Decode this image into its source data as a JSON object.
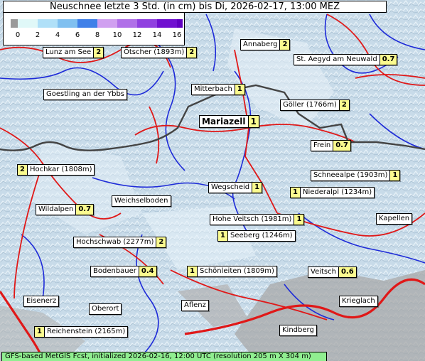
{
  "title": "Neuschnee letzte 3 Std. (in cm) bis Di, 2026-02-17, 13:00 MEZ",
  "legend": {
    "ticks": [
      "0",
      "2",
      "4",
      "6",
      "8",
      "10",
      "12",
      "14",
      "16"
    ],
    "colors": [
      "#e0f8f8",
      "#b0e0f8",
      "#80c0f0",
      "#4080e8",
      "#d0a0f0",
      "#b070e8",
      "#9040e0",
      "#7010d0"
    ],
    "start_color": "#9a9a9a",
    "end_color": "#6000c0"
  },
  "places": [
    {
      "name": "Lunz am See",
      "value": "2"
    },
    {
      "name": "Ötscher (1893m)",
      "value": "2"
    },
    {
      "name": "Annaberg",
      "value": "2"
    },
    {
      "name": "St. Aegyd am Neuwald",
      "value": "0.7"
    },
    {
      "name": "Goestling an der Ybbs",
      "value": ""
    },
    {
      "name": "Mitterbach",
      "value": "1"
    },
    {
      "name": "Göller (1766m)",
      "value": "2"
    },
    {
      "name": "Mariazell",
      "value": "1"
    },
    {
      "name": "Frein",
      "value": "0.7"
    },
    {
      "name": "Hochkar (1808m)",
      "value": "2"
    },
    {
      "name": "Schneealpe (1903m)",
      "value": "1"
    },
    {
      "name": "Wegscheid",
      "value": "1"
    },
    {
      "name": "Niederalpl (1234m)",
      "value": "1"
    },
    {
      "name": "Weichselboden",
      "value": ""
    },
    {
      "name": "Wildalpen",
      "value": "0.7"
    },
    {
      "name": "Hohe Veitsch (1981m)",
      "value": "1"
    },
    {
      "name": "Kapellen",
      "value": ""
    },
    {
      "name": "Seeberg (1246m)",
      "value": "1"
    },
    {
      "name": "Hochschwab (2277m)",
      "value": "2"
    },
    {
      "name": "Bodenbauer",
      "value": "0.4"
    },
    {
      "name": "Schönleiten (1809m)",
      "value": "1"
    },
    {
      "name": "Veitsch",
      "value": "0.6"
    },
    {
      "name": "Eisenerz",
      "value": ""
    },
    {
      "name": "Oberort",
      "value": ""
    },
    {
      "name": "Aflenz",
      "value": ""
    },
    {
      "name": "Krieglach",
      "value": ""
    },
    {
      "name": "Reichenstein (2165m)",
      "value": "1"
    },
    {
      "name": "Kindberg",
      "value": ""
    }
  ],
  "footer": "GFS-based MetGIS Fcst, initialized 2026-02-16, 12:00 UTC  (resolution 205 m X 304 m)"
}
